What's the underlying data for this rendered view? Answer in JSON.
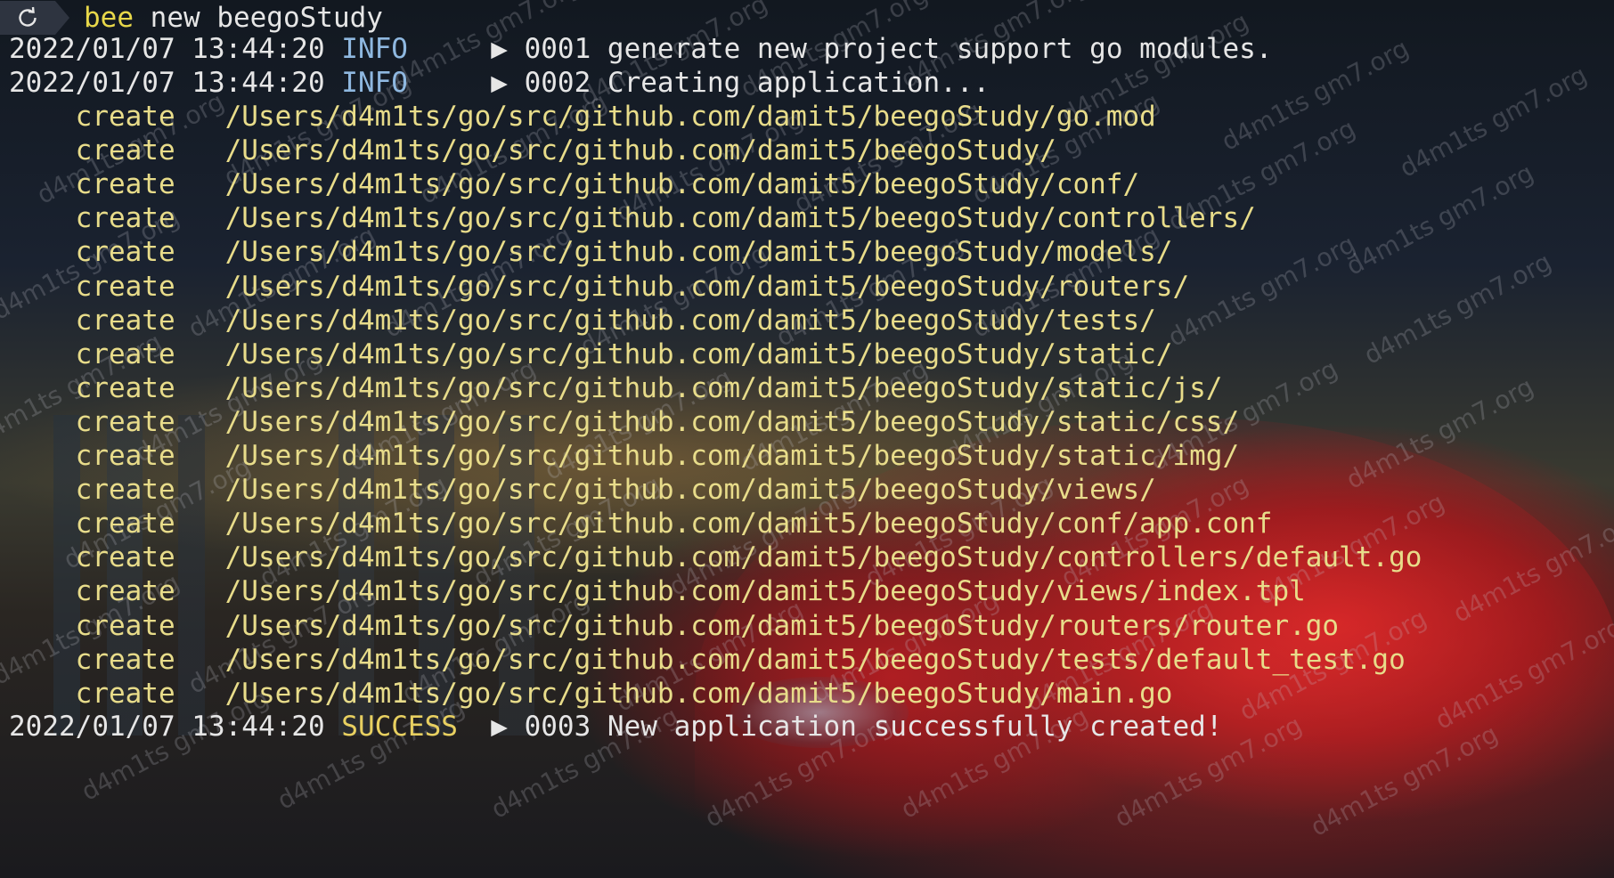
{
  "prompt": {
    "command_name": "bee",
    "command_args": " new beegoStudy"
  },
  "log_lines": [
    {
      "timestamp": "2022/01/07 13:44:20",
      "level": "INFO",
      "arrow": "▶",
      "message": "0001 generate new project support go modules."
    },
    {
      "timestamp": "2022/01/07 13:44:20",
      "level": "INFO",
      "arrow": "▶",
      "message": "0002 Creating application..."
    }
  ],
  "create_label": "create",
  "created_paths": [
    "/Users/d4m1ts/go/src/github.com/damit5/beegoStudy/go.mod",
    "/Users/d4m1ts/go/src/github.com/damit5/beegoStudy/",
    "/Users/d4m1ts/go/src/github.com/damit5/beegoStudy/conf/",
    "/Users/d4m1ts/go/src/github.com/damit5/beegoStudy/controllers/",
    "/Users/d4m1ts/go/src/github.com/damit5/beegoStudy/models/",
    "/Users/d4m1ts/go/src/github.com/damit5/beegoStudy/routers/",
    "/Users/d4m1ts/go/src/github.com/damit5/beegoStudy/tests/",
    "/Users/d4m1ts/go/src/github.com/damit5/beegoStudy/static/",
    "/Users/d4m1ts/go/src/github.com/damit5/beegoStudy/static/js/",
    "/Users/d4m1ts/go/src/github.com/damit5/beegoStudy/static/css/",
    "/Users/d4m1ts/go/src/github.com/damit5/beegoStudy/static/img/",
    "/Users/d4m1ts/go/src/github.com/damit5/beegoStudy/views/",
    "/Users/d4m1ts/go/src/github.com/damit5/beegoStudy/conf/app.conf",
    "/Users/d4m1ts/go/src/github.com/damit5/beegoStudy/controllers/default.go",
    "/Users/d4m1ts/go/src/github.com/damit5/beegoStudy/views/index.tpl",
    "/Users/d4m1ts/go/src/github.com/damit5/beegoStudy/routers/router.go",
    "/Users/d4m1ts/go/src/github.com/damit5/beegoStudy/tests/default_test.go",
    "/Users/d4m1ts/go/src/github.com/damit5/beegoStudy/main.go"
  ],
  "success_line": {
    "timestamp": "2022/01/07 13:44:20",
    "level": "SUCCESS",
    "arrow": "▶",
    "message": "0003 New application successfully created!"
  },
  "watermark_text": "d4m1ts gm7.org",
  "colors": {
    "info": "#8fb8e0",
    "success": "#e8d060",
    "create": "#e8dc8a",
    "command": "#e8d84a",
    "text": "#e6e6e6"
  }
}
